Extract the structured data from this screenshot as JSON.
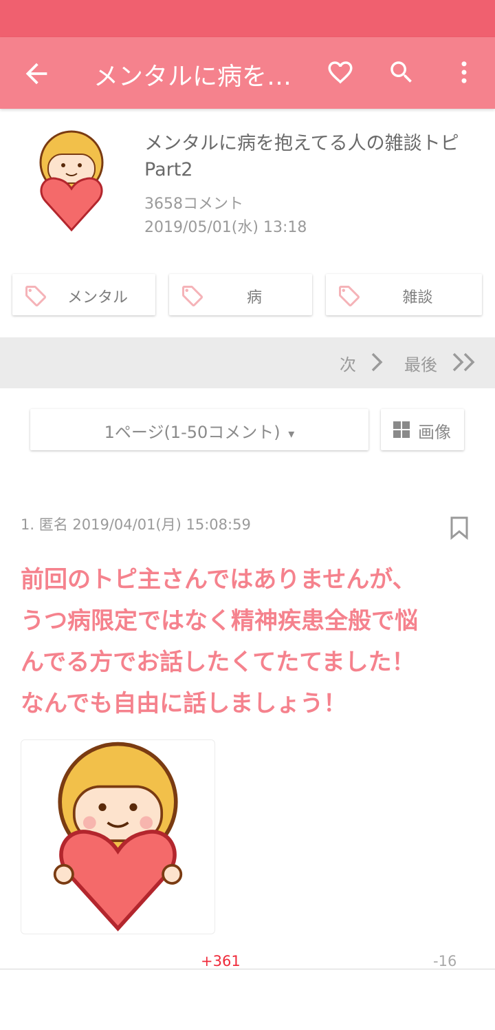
{
  "appbar": {
    "title": "メンタルに病を…",
    "icons": [
      "back-arrow-icon",
      "heart-icon",
      "search-icon",
      "more-vert-icon"
    ]
  },
  "topic": {
    "title": "メンタルに病を抱えてる人の雑談トピPart2",
    "comment_count": "3658コメント",
    "date": "2019/05/01(水) 13:18"
  },
  "tags": [
    "メンタル",
    "病",
    "雑談"
  ],
  "pager": {
    "next": "次",
    "last": "最後"
  },
  "page_select": {
    "label": "1ページ(1-50コメント)",
    "arrow": "▾"
  },
  "image_button": {
    "label": "画像"
  },
  "comment": {
    "meta": "1. 匿名 2019/04/01(月) 15:08:59",
    "lines": [
      "前回のトピ主さんではありませんが、",
      "うつ病限定ではなく精神疾患全般で悩",
      "んでる方でお話したくてたてました！",
      "なんでも自由に話しましょう！"
    ],
    "plus": "+361",
    "minus": "-16"
  },
  "colors": {
    "statusbar": "#f0606f",
    "appbar": "#f5828d",
    "accent_text": "#f5828d",
    "plus": "#ef2a3a"
  }
}
